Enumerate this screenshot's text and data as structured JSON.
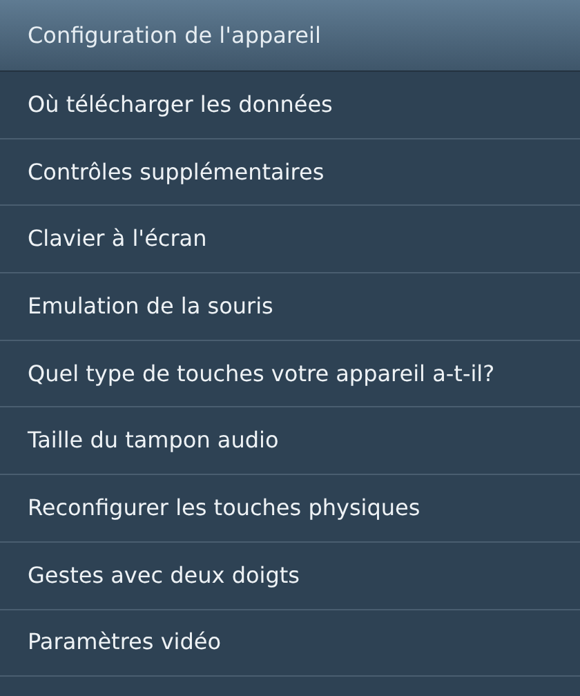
{
  "header": {
    "title": "Configuration de l'appareil"
  },
  "menu": {
    "items": [
      {
        "label": "Où télécharger les données"
      },
      {
        "label": "Contrôles supplémentaires"
      },
      {
        "label": "Clavier à l'écran"
      },
      {
        "label": "Emulation de la souris"
      },
      {
        "label": "Quel type de touches votre appareil a-t-il?"
      },
      {
        "label": "Taille du tampon audio"
      },
      {
        "label": "Reconfigurer les touches physiques"
      },
      {
        "label": "Gestes avec deux doigts"
      },
      {
        "label": "Paramètres vidéo"
      }
    ]
  }
}
